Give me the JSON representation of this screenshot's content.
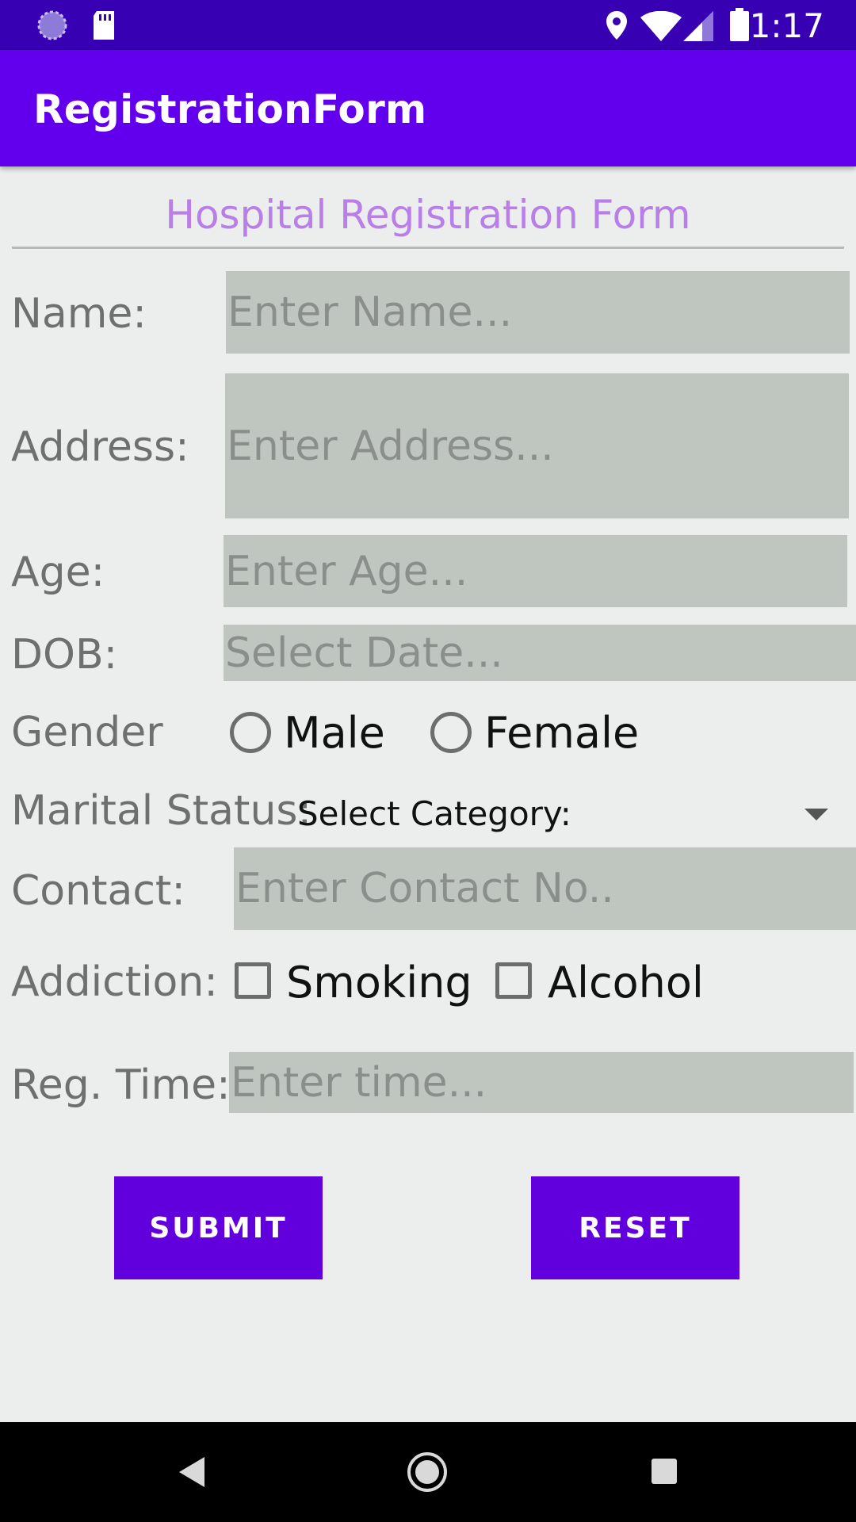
{
  "status_bar": {
    "time": "1:17",
    "icons": [
      "sync-icon",
      "sd-card-icon",
      "location-icon",
      "wifi-icon",
      "cell-signal-icon",
      "battery-icon"
    ]
  },
  "app_bar": {
    "title": "RegistrationForm"
  },
  "form": {
    "heading": "Hospital Registration Form",
    "name": {
      "label": "Name:",
      "placeholder": "Enter Name..."
    },
    "address": {
      "label": "Address:",
      "placeholder": "Enter Address..."
    },
    "age": {
      "label": "Age:",
      "placeholder": "Enter Age..."
    },
    "dob": {
      "label": "DOB:",
      "placeholder": "Select Date..."
    },
    "gender": {
      "label": "Gender",
      "options": [
        "Male",
        "Female"
      ]
    },
    "marital_status": {
      "label": "Marital Status:",
      "selected": "Select Category:"
    },
    "contact": {
      "label": "Contact:",
      "placeholder": "Enter Contact No.."
    },
    "addiction": {
      "label": "Addiction:",
      "options": [
        "Smoking",
        "Alcohol"
      ]
    },
    "reg_time": {
      "label": "Reg. Time:",
      "placeholder": "Enter time..."
    }
  },
  "buttons": {
    "submit": "SUBMIT",
    "reset": "RESET"
  },
  "colors": {
    "status_bar": "#3700b3",
    "app_bar": "#6200ee",
    "heading": "#b97ee8",
    "field_bg": "#bfc6c0",
    "button": "#6200dd"
  }
}
